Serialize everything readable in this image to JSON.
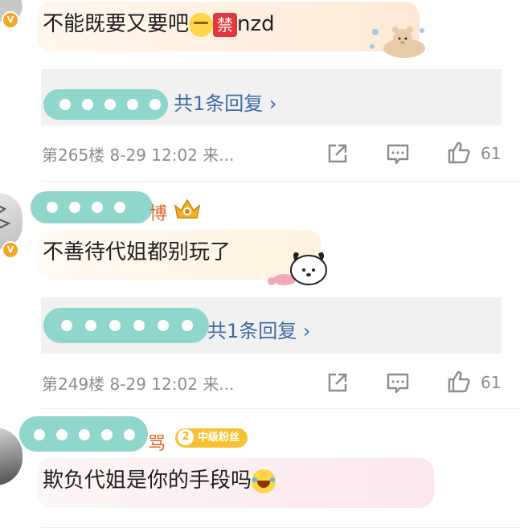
{
  "comments": [
    {
      "text": "不能既要又要吧",
      "tag": "禁",
      "suffix": "nzd",
      "reply_link": "共1条回复 ›",
      "meta": "第265楼  8-29 12:02 来...",
      "likes": "61"
    },
    {
      "username_fragment": "博",
      "text": "不善待代姐都别玩了",
      "reply_link": "共1条回复 ›",
      "meta": "第249楼  8-29 12:02 来...",
      "likes": "61"
    },
    {
      "username_fragment": "骂",
      "fan_level": "2",
      "fan_badge": "中级粉丝",
      "text": "欺负代姐是你的手段吗"
    }
  ],
  "colors": {
    "reply_link": "#3e6aa6",
    "meta": "#8c8c8c",
    "reply_bg": "#f1f1f1",
    "verified_badge": "#f5a623",
    "fan_badge": "#f7c232",
    "tag_red": "#e0383e"
  },
  "icons": [
    "share-icon",
    "comment-icon",
    "like-icon",
    "verified-badge-icon",
    "crown-icon"
  ]
}
